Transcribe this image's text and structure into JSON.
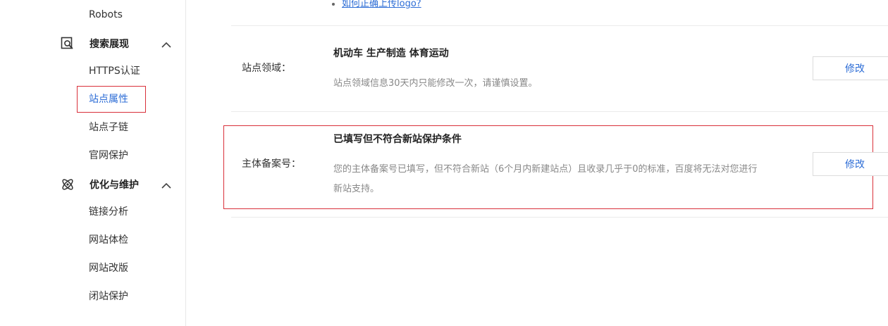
{
  "sidebar": {
    "robots_label": "Robots",
    "section_search": {
      "title": "搜索展现",
      "icon": "search-page-icon",
      "items": [
        {
          "label": "HTTPS认证"
        },
        {
          "label": "站点属性",
          "active": true
        },
        {
          "label": "站点子链"
        },
        {
          "label": "官网保护"
        }
      ]
    },
    "section_optimize": {
      "title": "优化与维护",
      "icon": "atom-icon",
      "items": [
        {
          "label": "链接分析"
        },
        {
          "label": "网站体检"
        },
        {
          "label": "网站改版"
        },
        {
          "label": "闭站保护"
        }
      ]
    }
  },
  "main": {
    "top_link": "如何正确上传logo?",
    "domain_row": {
      "label": "站点领域：",
      "value": "机动车 生产制造 体育运动",
      "desc": "站点领域信息30天内只能修改一次，请谨慎设置。",
      "button": "修改"
    },
    "record_row": {
      "label": "主体备案号：",
      "value": "已填写但不符合新站保护条件",
      "desc_line1": "您的主体备案号已填写，但不符合新站（6个月内新建站点）且收录几乎于0的标准，百度将无法对您进行",
      "desc_line2": "新站支持。",
      "button": "修改"
    }
  },
  "colors": {
    "accent": "#2d6dd6",
    "highlight": "#d9303a",
    "muted_text": "#888888"
  }
}
